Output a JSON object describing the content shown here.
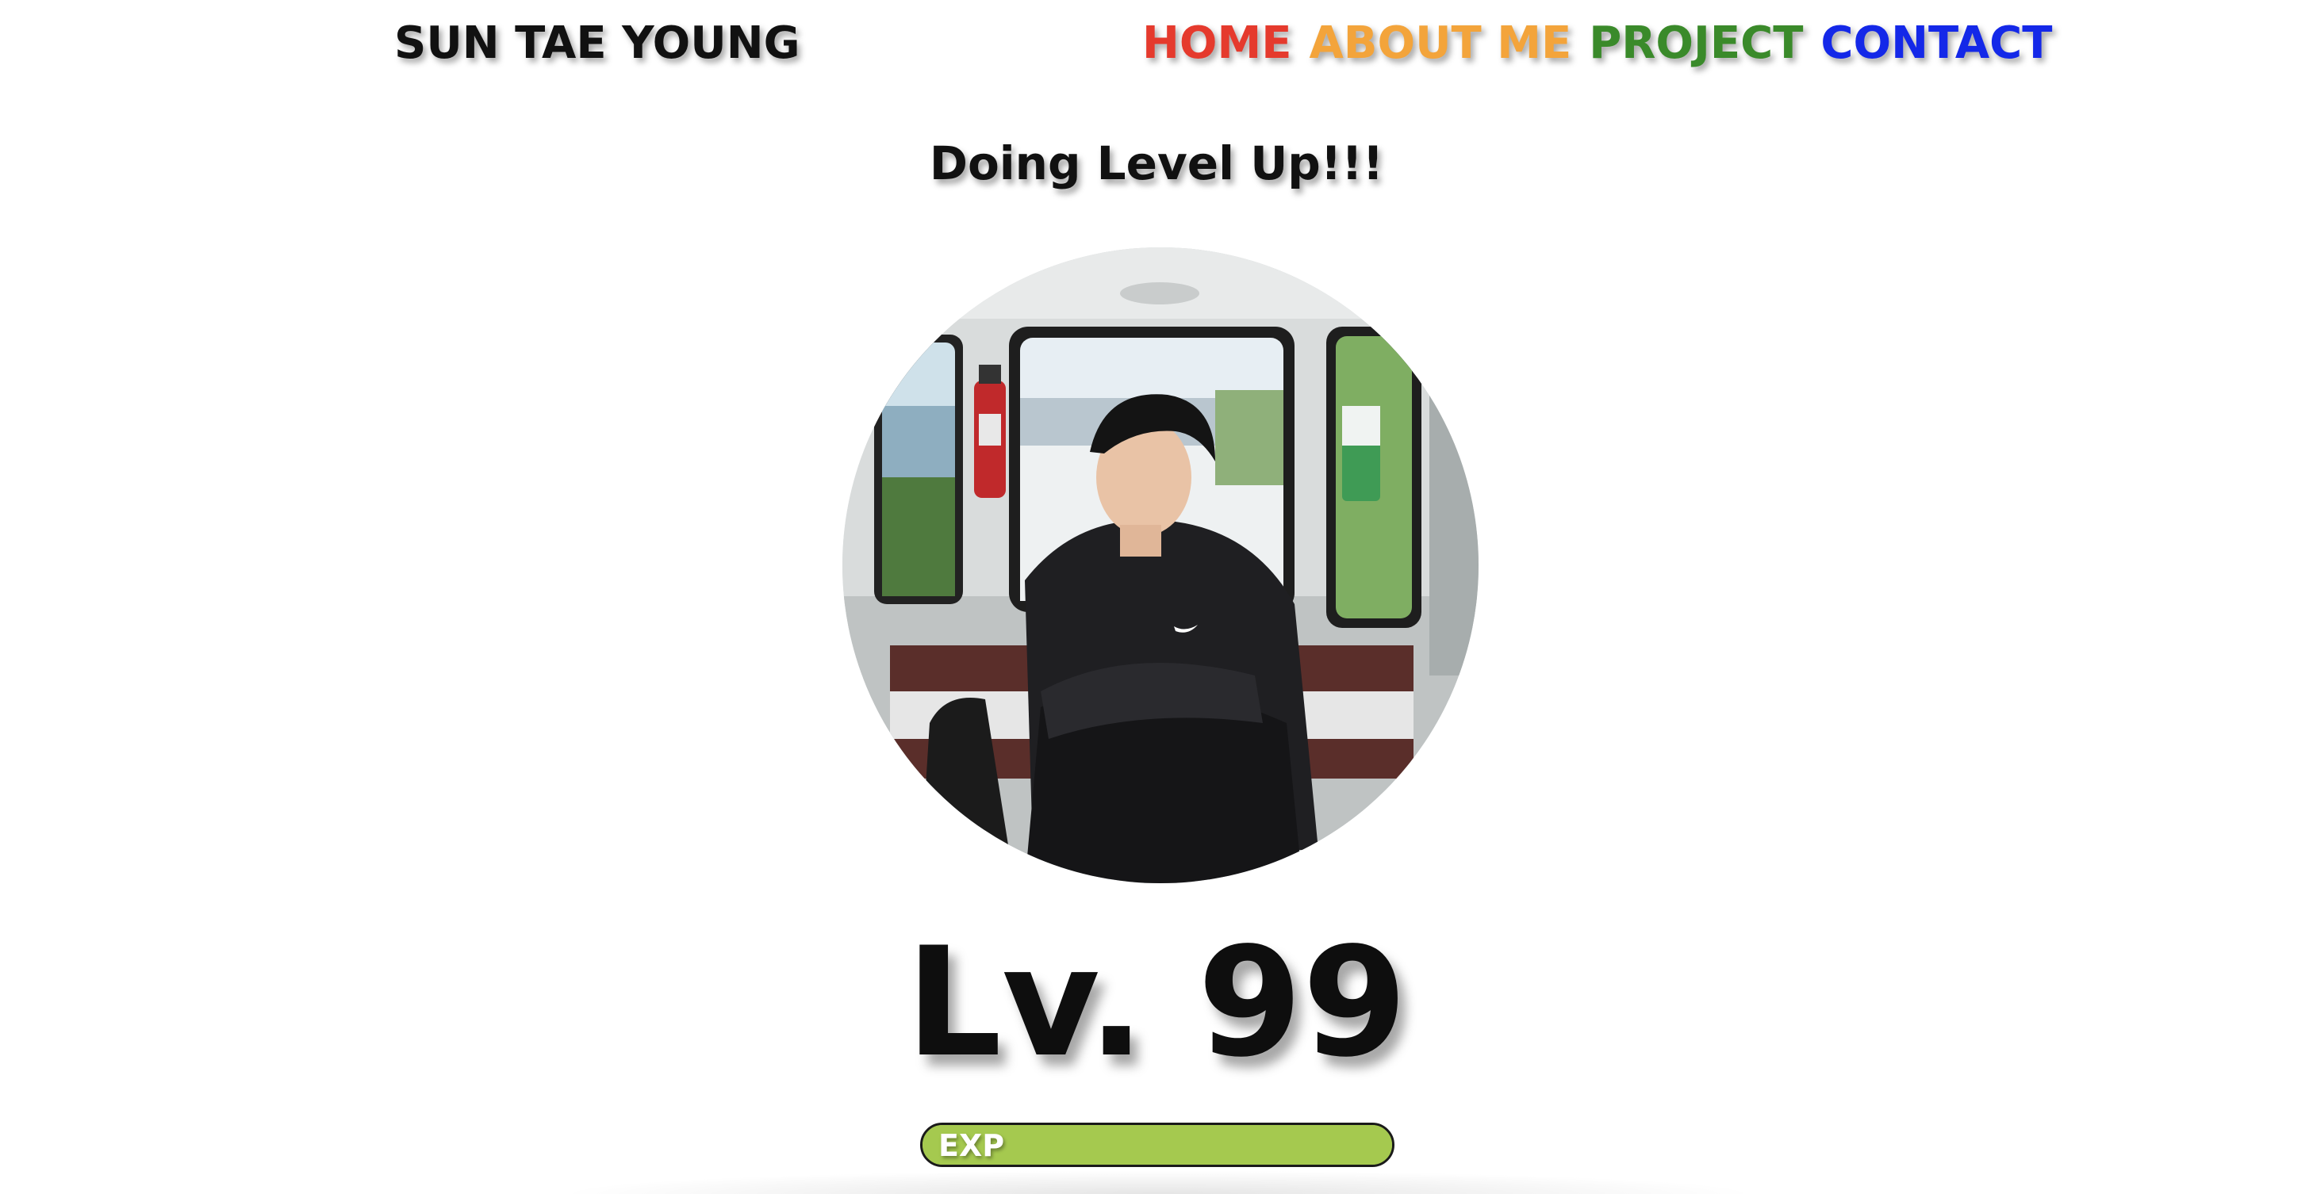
{
  "header": {
    "brand": "SUN TAE YOUNG",
    "nav": [
      {
        "label": "HOME",
        "color": "#e53a2d"
      },
      {
        "label": "ABOUT ME",
        "color": "#f3a43b"
      },
      {
        "label": "PROJECT",
        "color": "#3a8a2a"
      },
      {
        "label": "CONTACT",
        "color": "#1428e8"
      }
    ]
  },
  "main": {
    "tagline": "Doing Level Up!!!",
    "avatar_icon": "profile-photo",
    "level_text": "Lv. 99",
    "exp": {
      "label": "EXP",
      "progress": 1.0,
      "color": "#a5c94f"
    }
  }
}
